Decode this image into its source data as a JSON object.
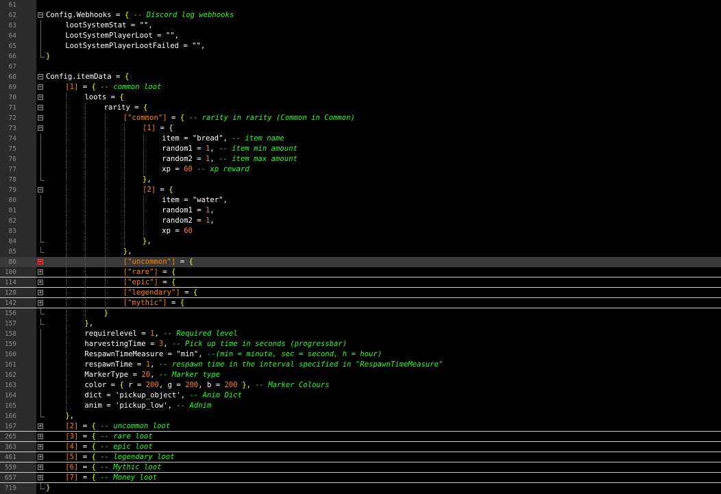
{
  "editor": {
    "colors": {
      "background": "#000000",
      "gutter": "#2b2b2b",
      "line_number": "#8f8f8f",
      "comment": "#1aff1a",
      "number": "#ff8000",
      "brace": "#ffff00",
      "text": "#ffffff",
      "current_line": "#3a3a3a",
      "breakpoint": "#b01010"
    },
    "lines": [
      {
        "n": "61",
        "indent": 0,
        "fold": "",
        "tokens": []
      },
      {
        "n": "62",
        "indent": 0,
        "fold": "minus",
        "tokens": [
          [
            "id",
            "Config.Webhooks"
          ],
          [
            "op",
            " = "
          ],
          [
            "brc",
            "{"
          ],
          [
            "op",
            " "
          ],
          [
            "com",
            "-- Discord log webhooks"
          ]
        ]
      },
      {
        "n": "63",
        "indent": 1,
        "fold": "line",
        "tokens": [
          [
            "id",
            "lootSystemStat"
          ],
          [
            "op",
            " = "
          ],
          [
            "str",
            "\"\""
          ],
          [
            "op",
            ","
          ]
        ]
      },
      {
        "n": "64",
        "indent": 1,
        "fold": "line",
        "tokens": [
          [
            "id",
            "LootSystemPlayerLoot"
          ],
          [
            "op",
            " = "
          ],
          [
            "str",
            "\"\""
          ],
          [
            "op",
            ","
          ]
        ]
      },
      {
        "n": "65",
        "indent": 1,
        "fold": "line",
        "tokens": [
          [
            "id",
            "LootSystemPlayerLootFailed"
          ],
          [
            "op",
            " = "
          ],
          [
            "str",
            "\"\""
          ],
          [
            "op",
            ","
          ]
        ]
      },
      {
        "n": "66",
        "indent": 0,
        "fold": "end",
        "tokens": [
          [
            "brc",
            "}"
          ]
        ]
      },
      {
        "n": "67",
        "indent": 0,
        "fold": "",
        "tokens": []
      },
      {
        "n": "68",
        "indent": 0,
        "fold": "minus",
        "tokens": [
          [
            "id",
            "Config.itemData"
          ],
          [
            "op",
            " = "
          ],
          [
            "brc",
            "{"
          ]
        ]
      },
      {
        "n": "69",
        "indent": 1,
        "fold": "minus",
        "tokens": [
          [
            "idx",
            "[1]"
          ],
          [
            "op",
            " = "
          ],
          [
            "brc",
            "{"
          ],
          [
            "op",
            " "
          ],
          [
            "com",
            "-- common loot"
          ]
        ]
      },
      {
        "n": "70",
        "indent": 2,
        "fold": "minus",
        "tokens": [
          [
            "id",
            "loots"
          ],
          [
            "op",
            " = "
          ],
          [
            "brc",
            "{"
          ]
        ]
      },
      {
        "n": "71",
        "indent": 3,
        "fold": "minus",
        "tokens": [
          [
            "id",
            "rarity"
          ],
          [
            "op",
            " = "
          ],
          [
            "brc",
            "{"
          ]
        ]
      },
      {
        "n": "72",
        "indent": 4,
        "fold": "minus",
        "tokens": [
          [
            "idx",
            "[\"common\"]"
          ],
          [
            "op",
            " = "
          ],
          [
            "brc",
            "{"
          ],
          [
            "op",
            " "
          ],
          [
            "com",
            "-- rarity in rarity (Common in Common)"
          ]
        ]
      },
      {
        "n": "73",
        "indent": 5,
        "fold": "minus",
        "tokens": [
          [
            "idx",
            "[1]"
          ],
          [
            "op",
            " = "
          ],
          [
            "brc",
            "{"
          ]
        ]
      },
      {
        "n": "74",
        "indent": 6,
        "fold": "line",
        "tokens": [
          [
            "id",
            "item"
          ],
          [
            "op",
            " = "
          ],
          [
            "str",
            "\"bread\""
          ],
          [
            "op",
            ", "
          ],
          [
            "com",
            "-- item name"
          ]
        ]
      },
      {
        "n": "75",
        "indent": 6,
        "fold": "line",
        "tokens": [
          [
            "id",
            "random1"
          ],
          [
            "op",
            " = "
          ],
          [
            "num",
            "1"
          ],
          [
            "op",
            ", "
          ],
          [
            "com",
            "-- item min amount"
          ]
        ]
      },
      {
        "n": "76",
        "indent": 6,
        "fold": "line",
        "tokens": [
          [
            "id",
            "random2"
          ],
          [
            "op",
            " = "
          ],
          [
            "num",
            "1"
          ],
          [
            "op",
            ", "
          ],
          [
            "com",
            "-- item max amount"
          ]
        ]
      },
      {
        "n": "77",
        "indent": 6,
        "fold": "line",
        "tokens": [
          [
            "id",
            "xp"
          ],
          [
            "op",
            " = "
          ],
          [
            "num",
            "60"
          ],
          [
            "op",
            " "
          ],
          [
            "com",
            "-- xp reward"
          ]
        ]
      },
      {
        "n": "78",
        "indent": 5,
        "fold": "end",
        "tokens": [
          [
            "brc",
            "}"
          ],
          [
            "op",
            ","
          ]
        ]
      },
      {
        "n": "79",
        "indent": 5,
        "fold": "minus",
        "tokens": [
          [
            "idx",
            "[2]"
          ],
          [
            "op",
            " = "
          ],
          [
            "brc",
            "{"
          ]
        ]
      },
      {
        "n": "80",
        "indent": 6,
        "fold": "line",
        "tokens": [
          [
            "id",
            "item"
          ],
          [
            "op",
            " = "
          ],
          [
            "str",
            "\"water\""
          ],
          [
            "op",
            ","
          ]
        ]
      },
      {
        "n": "81",
        "indent": 6,
        "fold": "line",
        "tokens": [
          [
            "id",
            "random1"
          ],
          [
            "op",
            " = "
          ],
          [
            "num",
            "1"
          ],
          [
            "op",
            ","
          ]
        ]
      },
      {
        "n": "82",
        "indent": 6,
        "fold": "line",
        "tokens": [
          [
            "id",
            "random2"
          ],
          [
            "op",
            " = "
          ],
          [
            "num",
            "1"
          ],
          [
            "op",
            ","
          ]
        ]
      },
      {
        "n": "83",
        "indent": 6,
        "fold": "line",
        "tokens": [
          [
            "id",
            "xp"
          ],
          [
            "op",
            " = "
          ],
          [
            "num",
            "60"
          ]
        ]
      },
      {
        "n": "84",
        "indent": 5,
        "fold": "end",
        "tokens": [
          [
            "brc",
            "}"
          ],
          [
            "op",
            ","
          ]
        ]
      },
      {
        "n": "85",
        "indent": 4,
        "fold": "end",
        "tokens": [
          [
            "brc",
            "}"
          ],
          [
            "op",
            ","
          ]
        ]
      },
      {
        "n": "86",
        "indent": 4,
        "fold": "bp",
        "current": true,
        "tokens": [
          [
            "idx",
            "[\"uncommon\"]"
          ],
          [
            "op",
            " = "
          ],
          [
            "brc",
            "{"
          ]
        ]
      },
      {
        "n": "100",
        "indent": 4,
        "fold": "plus",
        "folded": true,
        "tokens": [
          [
            "idx",
            "[\"rare\"]"
          ],
          [
            "op",
            " = "
          ],
          [
            "brc",
            "{"
          ]
        ]
      },
      {
        "n": "114",
        "indent": 4,
        "fold": "plus",
        "folded": true,
        "tokens": [
          [
            "idx",
            "[\"epic\"]"
          ],
          [
            "op",
            " = "
          ],
          [
            "brc",
            "{"
          ]
        ]
      },
      {
        "n": "128",
        "indent": 4,
        "fold": "plus",
        "folded": true,
        "tokens": [
          [
            "idx",
            "[\"legendary\"]"
          ],
          [
            "op",
            " = "
          ],
          [
            "brc",
            "{"
          ]
        ]
      },
      {
        "n": "142",
        "indent": 4,
        "fold": "plus",
        "folded": true,
        "tokens": [
          [
            "idx",
            "[\"mythic\"]"
          ],
          [
            "op",
            " = "
          ],
          [
            "brc",
            "{"
          ]
        ]
      },
      {
        "n": "156",
        "indent": 3,
        "fold": "end",
        "tokens": [
          [
            "brc",
            "}"
          ]
        ]
      },
      {
        "n": "157",
        "indent": 2,
        "fold": "end",
        "tokens": [
          [
            "brc",
            "}"
          ],
          [
            "op",
            ","
          ]
        ]
      },
      {
        "n": "158",
        "indent": 2,
        "fold": "line",
        "tokens": [
          [
            "id",
            "requirelevel"
          ],
          [
            "op",
            " = "
          ],
          [
            "num",
            "1"
          ],
          [
            "op",
            ", "
          ],
          [
            "com",
            "-- Required level"
          ]
        ]
      },
      {
        "n": "159",
        "indent": 2,
        "fold": "line",
        "tokens": [
          [
            "id",
            "harvestingTime"
          ],
          [
            "op",
            " = "
          ],
          [
            "num",
            "3"
          ],
          [
            "op",
            ", "
          ],
          [
            "com",
            "-- Pick up time in seconds (progressbar)"
          ]
        ]
      },
      {
        "n": "160",
        "indent": 2,
        "fold": "line",
        "tokens": [
          [
            "id",
            "RespawnTimeMeasure"
          ],
          [
            "op",
            " = "
          ],
          [
            "str",
            "\"min\""
          ],
          [
            "op",
            ", "
          ],
          [
            "com",
            "--(min = minute, sec = second, h = hour)"
          ]
        ]
      },
      {
        "n": "161",
        "indent": 2,
        "fold": "line",
        "tokens": [
          [
            "id",
            "respawnTime"
          ],
          [
            "op",
            " = "
          ],
          [
            "num",
            "1"
          ],
          [
            "op",
            ", "
          ],
          [
            "com",
            "-- respawn time in the interval specified in \"RespawnTimeMeasure\""
          ]
        ]
      },
      {
        "n": "162",
        "indent": 2,
        "fold": "line",
        "tokens": [
          [
            "id",
            "MarkerType"
          ],
          [
            "op",
            " = "
          ],
          [
            "num",
            "20"
          ],
          [
            "op",
            ", "
          ],
          [
            "com",
            "-- Marker type"
          ]
        ]
      },
      {
        "n": "163",
        "indent": 2,
        "fold": "line",
        "tokens": [
          [
            "id",
            "color"
          ],
          [
            "op",
            " = "
          ],
          [
            "brc",
            "{"
          ],
          [
            "op",
            " r = "
          ],
          [
            "num",
            "200"
          ],
          [
            "op",
            ", g = "
          ],
          [
            "num",
            "200"
          ],
          [
            "op",
            ", b = "
          ],
          [
            "num",
            "200"
          ],
          [
            "op",
            " "
          ],
          [
            "brc",
            "}"
          ],
          [
            "op",
            ", "
          ],
          [
            "com",
            "-- Marker Colours"
          ]
        ]
      },
      {
        "n": "164",
        "indent": 2,
        "fold": "line",
        "tokens": [
          [
            "id",
            "dict"
          ],
          [
            "op",
            " = "
          ],
          [
            "str",
            "'pickup_object'"
          ],
          [
            "op",
            ", "
          ],
          [
            "com",
            "-- Anim Dict"
          ]
        ]
      },
      {
        "n": "165",
        "indent": 2,
        "fold": "line",
        "tokens": [
          [
            "id",
            "anim"
          ],
          [
            "op",
            " = "
          ],
          [
            "str",
            "'pickup_low'"
          ],
          [
            "op",
            ", "
          ],
          [
            "com",
            "-- Adnim"
          ]
        ]
      },
      {
        "n": "166",
        "indent": 1,
        "fold": "end",
        "tokens": [
          [
            "brc",
            "}"
          ],
          [
            "op",
            ","
          ]
        ]
      },
      {
        "n": "167",
        "indent": 1,
        "fold": "plus",
        "folded": true,
        "tokens": [
          [
            "idx",
            "[2]"
          ],
          [
            "op",
            " = "
          ],
          [
            "brc",
            "{"
          ],
          [
            "op",
            " "
          ],
          [
            "com",
            "-- uncommon loot"
          ]
        ]
      },
      {
        "n": "265",
        "indent": 1,
        "fold": "plus",
        "folded": true,
        "tokens": [
          [
            "idx",
            "[3]"
          ],
          [
            "op",
            " = "
          ],
          [
            "brc",
            "{"
          ],
          [
            "op",
            " "
          ],
          [
            "com",
            "-- rare loot"
          ]
        ]
      },
      {
        "n": "363",
        "indent": 1,
        "fold": "plus",
        "folded": true,
        "tokens": [
          [
            "idx",
            "[4]"
          ],
          [
            "op",
            " = "
          ],
          [
            "brc",
            "{"
          ],
          [
            "op",
            " "
          ],
          [
            "com",
            "-- epic loot"
          ]
        ]
      },
      {
        "n": "461",
        "indent": 1,
        "fold": "plus",
        "folded": true,
        "tokens": [
          [
            "idx",
            "[5]"
          ],
          [
            "op",
            " = "
          ],
          [
            "brc",
            "{"
          ],
          [
            "op",
            " "
          ],
          [
            "com",
            "-- legendary loot"
          ]
        ]
      },
      {
        "n": "559",
        "indent": 1,
        "fold": "plus",
        "folded": true,
        "tokens": [
          [
            "idx",
            "[6]"
          ],
          [
            "op",
            " = "
          ],
          [
            "brc",
            "{"
          ],
          [
            "op",
            " "
          ],
          [
            "com",
            "-- Mythic loot"
          ]
        ]
      },
      {
        "n": "657",
        "indent": 1,
        "fold": "plus",
        "folded": true,
        "tokens": [
          [
            "idx",
            "[7]"
          ],
          [
            "op",
            " = "
          ],
          [
            "brc",
            "{"
          ],
          [
            "op",
            " "
          ],
          [
            "com",
            "-- Money loot"
          ]
        ]
      },
      {
        "n": "719",
        "indent": 0,
        "fold": "end",
        "tokens": [
          [
            "brc",
            "}"
          ]
        ]
      }
    ]
  }
}
